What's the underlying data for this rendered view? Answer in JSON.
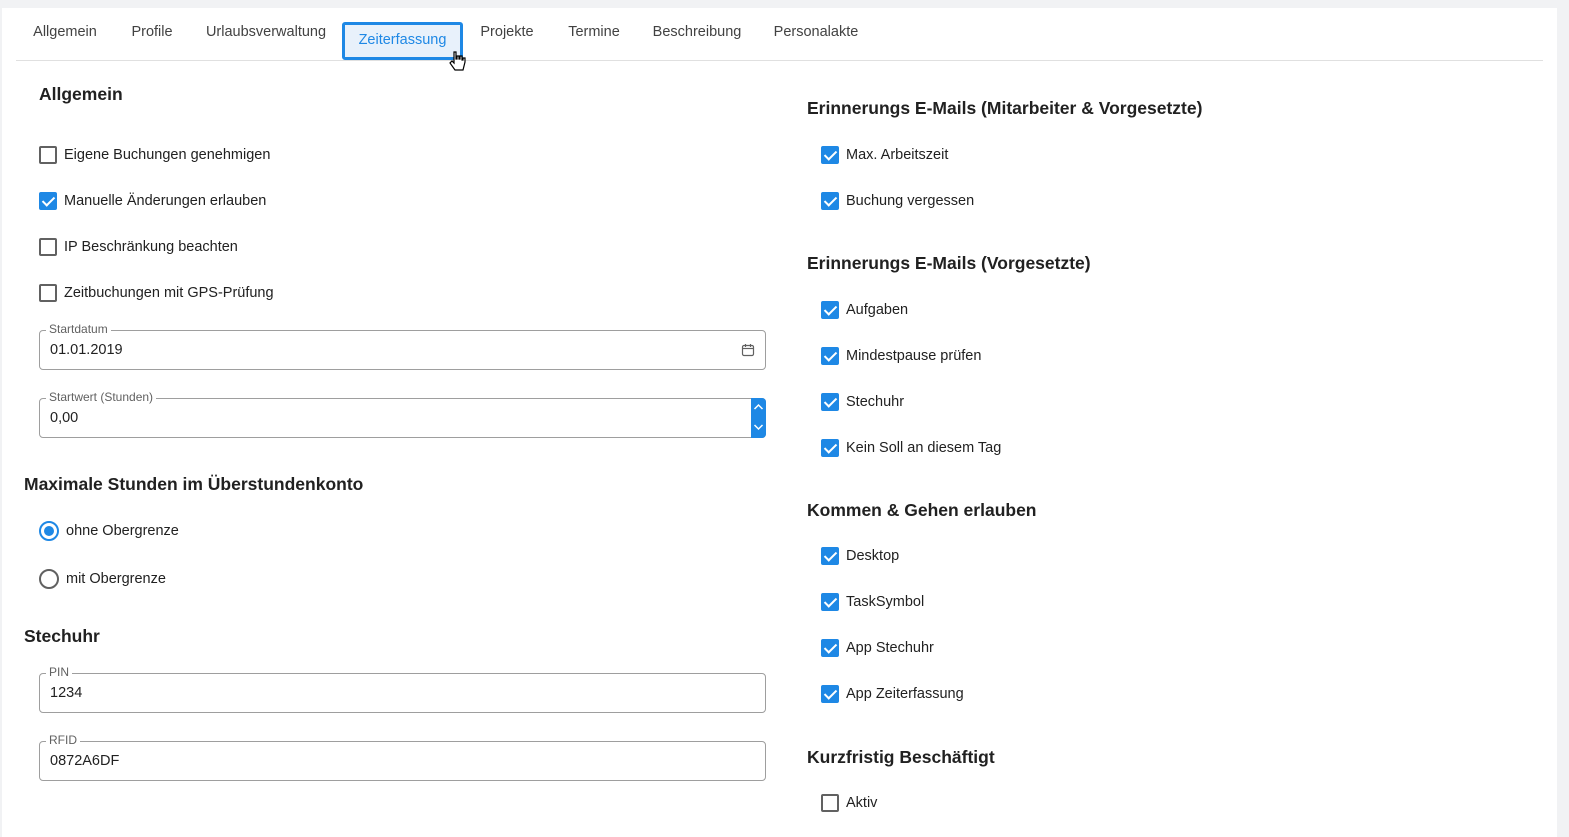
{
  "tabs": [
    {
      "label": "Allgemein",
      "active": false
    },
    {
      "label": "Profile",
      "active": false
    },
    {
      "label": "Urlaubsverwaltung",
      "active": false
    },
    {
      "label": "Zeiterfassung",
      "active": true
    },
    {
      "label": "Projekte",
      "active": false
    },
    {
      "label": "Termine",
      "active": false
    },
    {
      "label": "Beschreibung",
      "active": false
    },
    {
      "label": "Personalakte",
      "active": false
    }
  ],
  "left": {
    "general_title": "Allgemein",
    "general_options": [
      {
        "label": "Eigene Buchungen genehmigen",
        "checked": false
      },
      {
        "label": "Manuelle Änderungen erlauben",
        "checked": true
      },
      {
        "label": "IP Beschränkung beachten",
        "checked": false
      },
      {
        "label": "Zeitbuchungen mit GPS-Prüfung",
        "checked": false
      }
    ],
    "start_date": {
      "label": "Startdatum",
      "value": "01.01.2019",
      "icon": "calendar-icon"
    },
    "start_value": {
      "label": "Startwert (Stunden)",
      "value": "0,00"
    },
    "overtime_title": "Maximale Stunden im Überstundenkonto",
    "overtime_options": [
      {
        "label": "ohne Obergrenze",
        "selected": true
      },
      {
        "label": "mit Obergrenze",
        "selected": false
      }
    ],
    "clock_title": "Stechuhr",
    "pin": {
      "label": "PIN",
      "value": "1234"
    },
    "rfid": {
      "label": "RFID",
      "value": "0872A6DF"
    }
  },
  "right": {
    "reminder_all_title": "Erinnerungs E-Mails (Mitarbeiter & Vorgesetzte)",
    "reminder_all_options": [
      {
        "label": "Max. Arbeitszeit",
        "checked": true
      },
      {
        "label": "Buchung vergessen",
        "checked": true
      }
    ],
    "reminder_sup_title": "Erinnerungs E-Mails (Vorgesetzte)",
    "reminder_sup_options": [
      {
        "label": "Aufgaben",
        "checked": true
      },
      {
        "label": "Mindestpause prüfen",
        "checked": true
      },
      {
        "label": "Stechuhr",
        "checked": true
      },
      {
        "label": "Kein Soll an diesem Tag",
        "checked": true
      }
    ],
    "comego_title": "Kommen & Gehen erlauben",
    "comego_options": [
      {
        "label": "Desktop",
        "checked": true
      },
      {
        "label": "TaskSymbol",
        "checked": true
      },
      {
        "label": "App Stechuhr",
        "checked": true
      },
      {
        "label": "App Zeiterfassung",
        "checked": true
      }
    ],
    "shortterm_title": "Kurzfristig Beschäftigt",
    "shortterm_options": [
      {
        "label": "Aktiv",
        "checked": false
      }
    ]
  },
  "colors": {
    "accent": "#1e88e5",
    "border": "#9e9e9e",
    "text": "#212121"
  }
}
